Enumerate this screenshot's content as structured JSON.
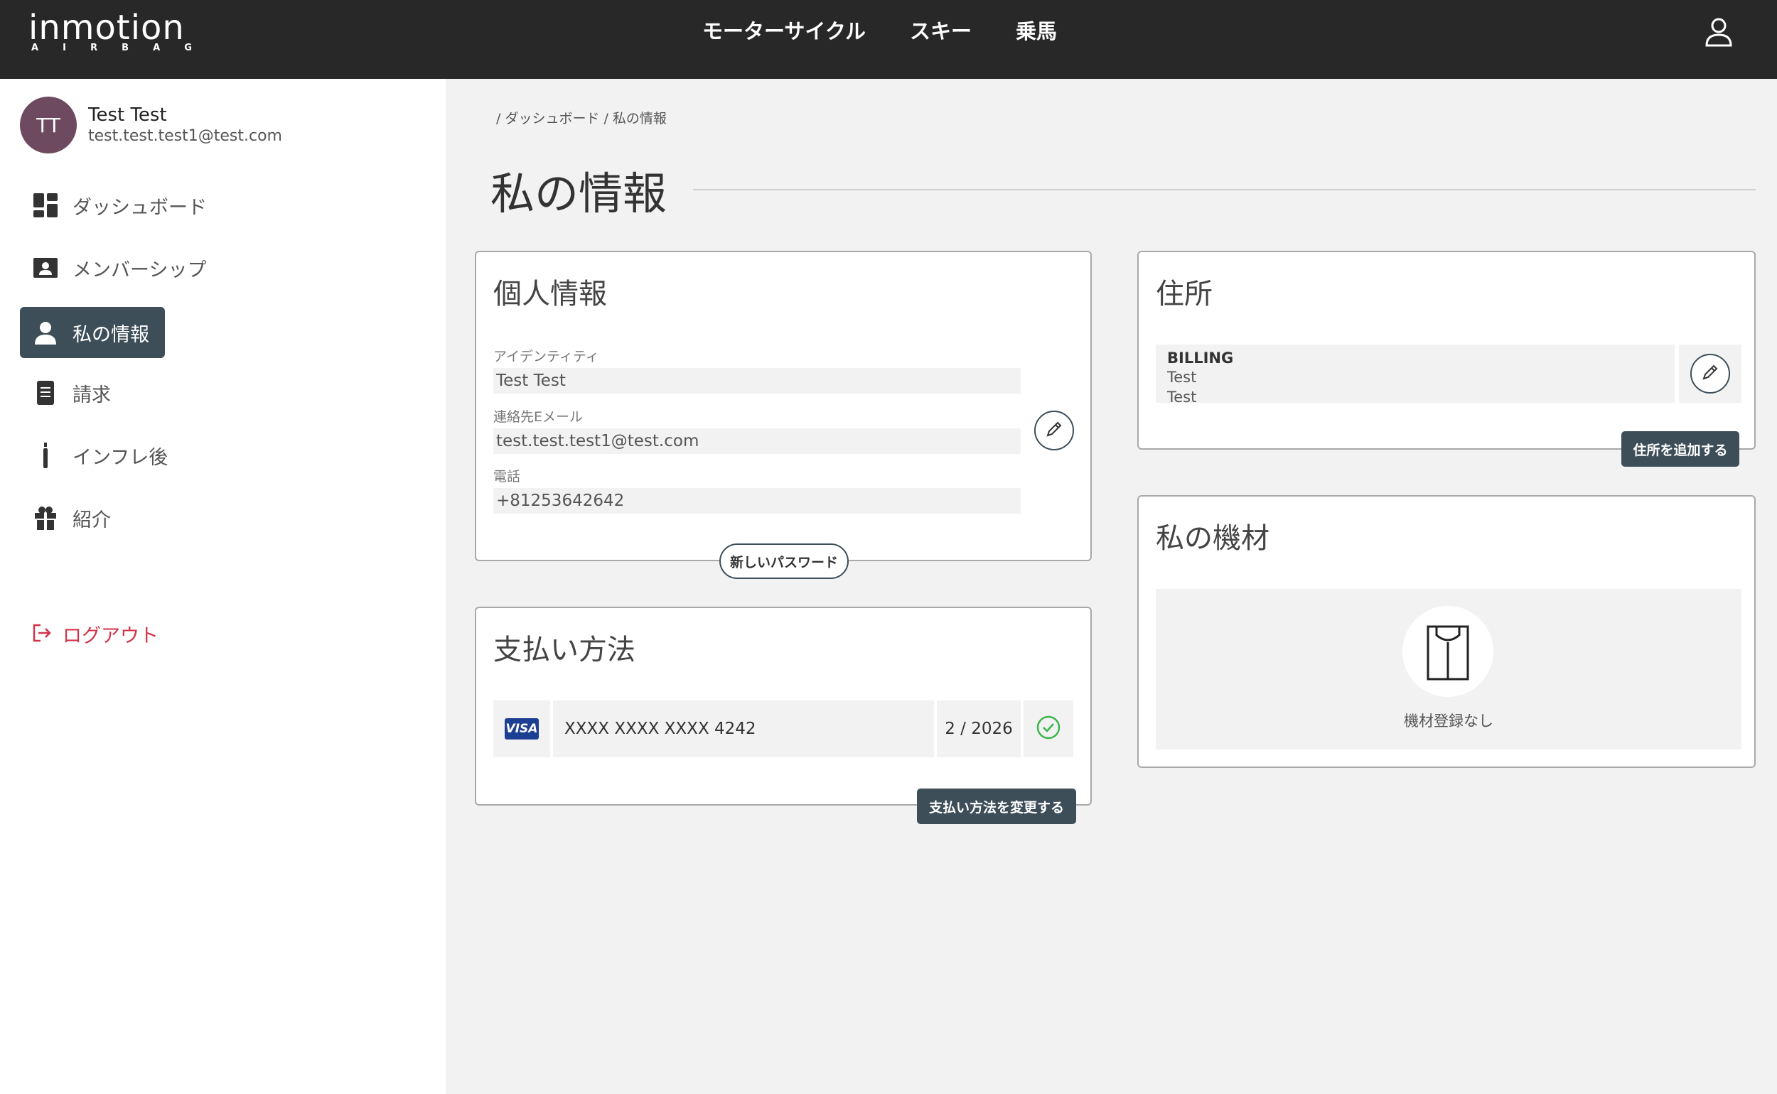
{
  "brand": {
    "logo_word": "inmotion",
    "logo_sub": [
      "A",
      "I",
      "R",
      "B",
      "A",
      "G"
    ]
  },
  "topnav": {
    "items": [
      "モーターサイクル",
      "スキー",
      "乗馬"
    ]
  },
  "profile": {
    "initials": "TT",
    "name": "Test Test",
    "email": "test.test.test1@test.com"
  },
  "sidebar": {
    "items": [
      {
        "label": "ダッシュボード",
        "icon": "dashboard-icon"
      },
      {
        "label": "メンバーシップ",
        "icon": "id-card-icon"
      },
      {
        "label": "私の情報",
        "icon": "person-icon",
        "active": true
      },
      {
        "label": "請求",
        "icon": "document-icon"
      },
      {
        "label": "インフレ後",
        "icon": "canister-icon"
      },
      {
        "label": "紹介",
        "icon": "gift-icon"
      }
    ],
    "logout": "ログアウト"
  },
  "breadcrumb": {
    "text": "/ ダッシュボード / 私の情報"
  },
  "page": {
    "title": "私の情報"
  },
  "personal": {
    "title": "個人情報",
    "identity_label": "アイデンティティ",
    "identity_value": "Test Test",
    "email_label": "連絡先Eメール",
    "email_value": "test.test.test1@test.com",
    "phone_label": "電話",
    "phone_value": "+81253642642",
    "password_button": "新しいパスワード"
  },
  "payment": {
    "title": "支払い方法",
    "card_brand": "VISA",
    "card_number": "XXXX XXXX XXXX 4242",
    "expiry": "2 / 2026",
    "change_button": "支払い方法を変更する"
  },
  "address": {
    "title": "住所",
    "billing_title": "BILLING",
    "billing_lines": [
      "Test",
      "Test"
    ],
    "add_button": "住所を追加する"
  },
  "equipment": {
    "title": "私の機材",
    "empty_text": "機材登録なし"
  },
  "colors": {
    "topbar": "#282828",
    "accent": "#3d4e59",
    "avatar": "#6e4a60",
    "logout": "#d0344a",
    "success": "#3bb54a"
  }
}
